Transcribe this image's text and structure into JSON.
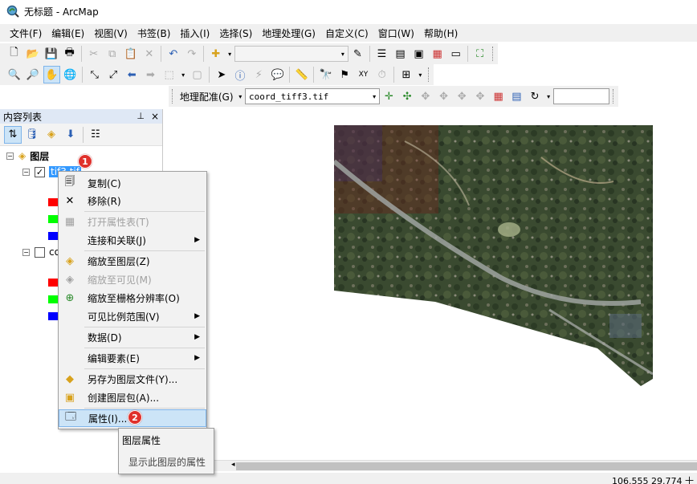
{
  "window": {
    "title": "无标题 - ArcMap"
  },
  "menu": [
    "文件(F)",
    "编辑(E)",
    "视图(V)",
    "书签(B)",
    "插入(I)",
    "选择(S)",
    "地理处理(G)",
    "自定义(C)",
    "窗口(W)",
    "帮助(H)"
  ],
  "georef_toolbar": {
    "menu_label": "地理配准(G)",
    "layer_value": "coord_tiff3.tif"
  },
  "toc": {
    "title": "内容列表",
    "pin": "ᵖ",
    "close": "×",
    "root_label": "图层",
    "layer1_label": "tif3.tif",
    "layer2_label": "co"
  },
  "context_menu": {
    "copy": "复制(C)",
    "remove": "移除(R)",
    "open_attr": "打开属性表(T)",
    "join": "连接和关联(J)",
    "zoom_layer": "缩放至图层(Z)",
    "zoom_visible": "缩放至可见(M)",
    "zoom_raster": "缩放至栅格分辨率(O)",
    "scale_range": "可见比例范围(V)",
    "data": "数据(D)",
    "edit_features": "编辑要素(E)",
    "save_layer": "另存为图层文件(Y)...",
    "create_package": "创建图层包(A)...",
    "properties": "属性(I)..."
  },
  "tooltip": {
    "title": "图层属性",
    "description": "显示此图层的属性"
  },
  "badges": {
    "step1": "1",
    "step2": "2"
  },
  "status": {
    "coords": "106.555 29.774 十"
  },
  "colors": {
    "accent_selected": "#3399ff",
    "menu_highlight": "#cce4f7",
    "badge": "#e0302b",
    "band_red": "#ff0000",
    "band_green": "#00ff00",
    "band_blue": "#0000ff"
  }
}
